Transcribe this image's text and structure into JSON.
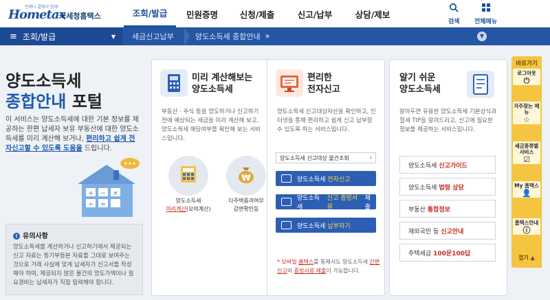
{
  "brand": {
    "tagline": "언제나 곁에서 함께",
    "name": "Hometax",
    "agency": "국세청홈택스"
  },
  "topnav": [
    {
      "label": "조회/발급",
      "active": true
    },
    {
      "label": "민원증명",
      "active": false
    },
    {
      "label": "신청/제출",
      "active": false
    },
    {
      "label": "신고/납부",
      "active": false
    },
    {
      "label": "상담/제보",
      "active": false
    }
  ],
  "tools": {
    "search": "검색",
    "all_menu": "전체메뉴"
  },
  "bluebar": {
    "menu": "조회/발급",
    "crumb1": "세금신고납부",
    "crumb2": "양도소득세 종합안내"
  },
  "intro": {
    "title_line1": "양도소득세",
    "title_line2_blue": "종합안내",
    "title_line2_rest": "포털",
    "desc_plain": "이 서비스는 양도소득세에 대한 기본 정보를 제공하는 한편 납세자 보유 부동산에 대한 양도소득세를 미리 계산해 보거나,",
    "desc_highlight": "편리하고 쉽게 전자신고할 수 있도록 도움을",
    "desc_end": "드립니다."
  },
  "notice": {
    "title": "유의사항",
    "text": "양도소득세를 계산하거나 신고하기에서 제공되는 신고 자료는 등기부등본 자료를 그대로 보여주는 것으로 거래 사실에 맞게 납세자가 신고서를 작성해야 하며, 제공되지 않은 물건의 양도가액이나 필요경비는 납세자가 직접 입력해야 합니다."
  },
  "card1": {
    "title_line1": "미리 계산해보는",
    "title_line2": "양도소득세",
    "desc": "부동산 · 주식 등을 양도하거나 신고하기 전에 예상되는 세금을 미리 계산해 보고, 양도소득세 해당여부를 확인해 보는 서비스입니다.",
    "opt1_line1": "양도소득세",
    "opt1_line2_red": "미리계산",
    "opt1_line2_rest": "(모의계산)",
    "opt2_line1": "다주택중과여부",
    "opt2_line2": "감면확인등"
  },
  "card2": {
    "title_line1": "편리한",
    "title_line2": "전자신고",
    "desc": "양도소득세 신고대상자산을 확인하고, 인터넷을 통해 편리하고 쉽게 신고 납부할 수 있도록 하는 서비스입니다.",
    "select_label": "양도소득세 신고대상 물건조회",
    "btn1": {
      "pre": "양도소득세",
      "hl": "전자신고",
      "post": ""
    },
    "btn2": {
      "pre": "양도소득세",
      "hl": "신고 증빙서류",
      "post": "제출"
    },
    "btn3": {
      "pre": "양도소득세",
      "hl": "납부하기",
      "post": ""
    },
    "mobile_note_pre": "* 모바일",
    "mobile_note_hl": "홈택스",
    "mobile_note_mid": "를 통해서도 양도소득세",
    "mobile_note_hl2": "간편신고",
    "mobile_note_and": "와",
    "mobile_note_hl3": "증빙서류 제출",
    "mobile_note_end": "이 가능합니다."
  },
  "card3": {
    "title_line1": "알기 쉬운",
    "title_line2": "양도소득세",
    "desc": "알아두면 유용한 양도소득세 기본상식과 절세 TIP을 알려드리고, 신고에 필요한 정보를 제공하는 서비스입니다.",
    "links": [
      {
        "pre": "양도소득세",
        "hl": "신고가이드"
      },
      {
        "pre": "양도소득세",
        "hl": "법령 상담"
      },
      {
        "pre": "부동산",
        "hl": "통합정보"
      },
      {
        "pre": "재외국민 등",
        "hl": "신고안내"
      },
      {
        "pre": "주택세금",
        "hl": "100문100답"
      }
    ]
  },
  "quick": {
    "head": "바로가기",
    "items": [
      {
        "label": "로그아웃",
        "icon": "logout-icon"
      },
      {
        "label": "자주찾는 메뉴",
        "icon": "star-icon"
      },
      {
        "label": "세금종류별 서비스",
        "icon": "check-icon"
      },
      {
        "label": "My 홈택스",
        "icon": "person-icon"
      },
      {
        "label": "홈택스안내",
        "icon": "info-icon"
      }
    ],
    "fold": "접기"
  },
  "colors": {
    "primary": "#2456a4",
    "accent_red": "#c8281f",
    "quick_yellow": "#f5c542"
  }
}
